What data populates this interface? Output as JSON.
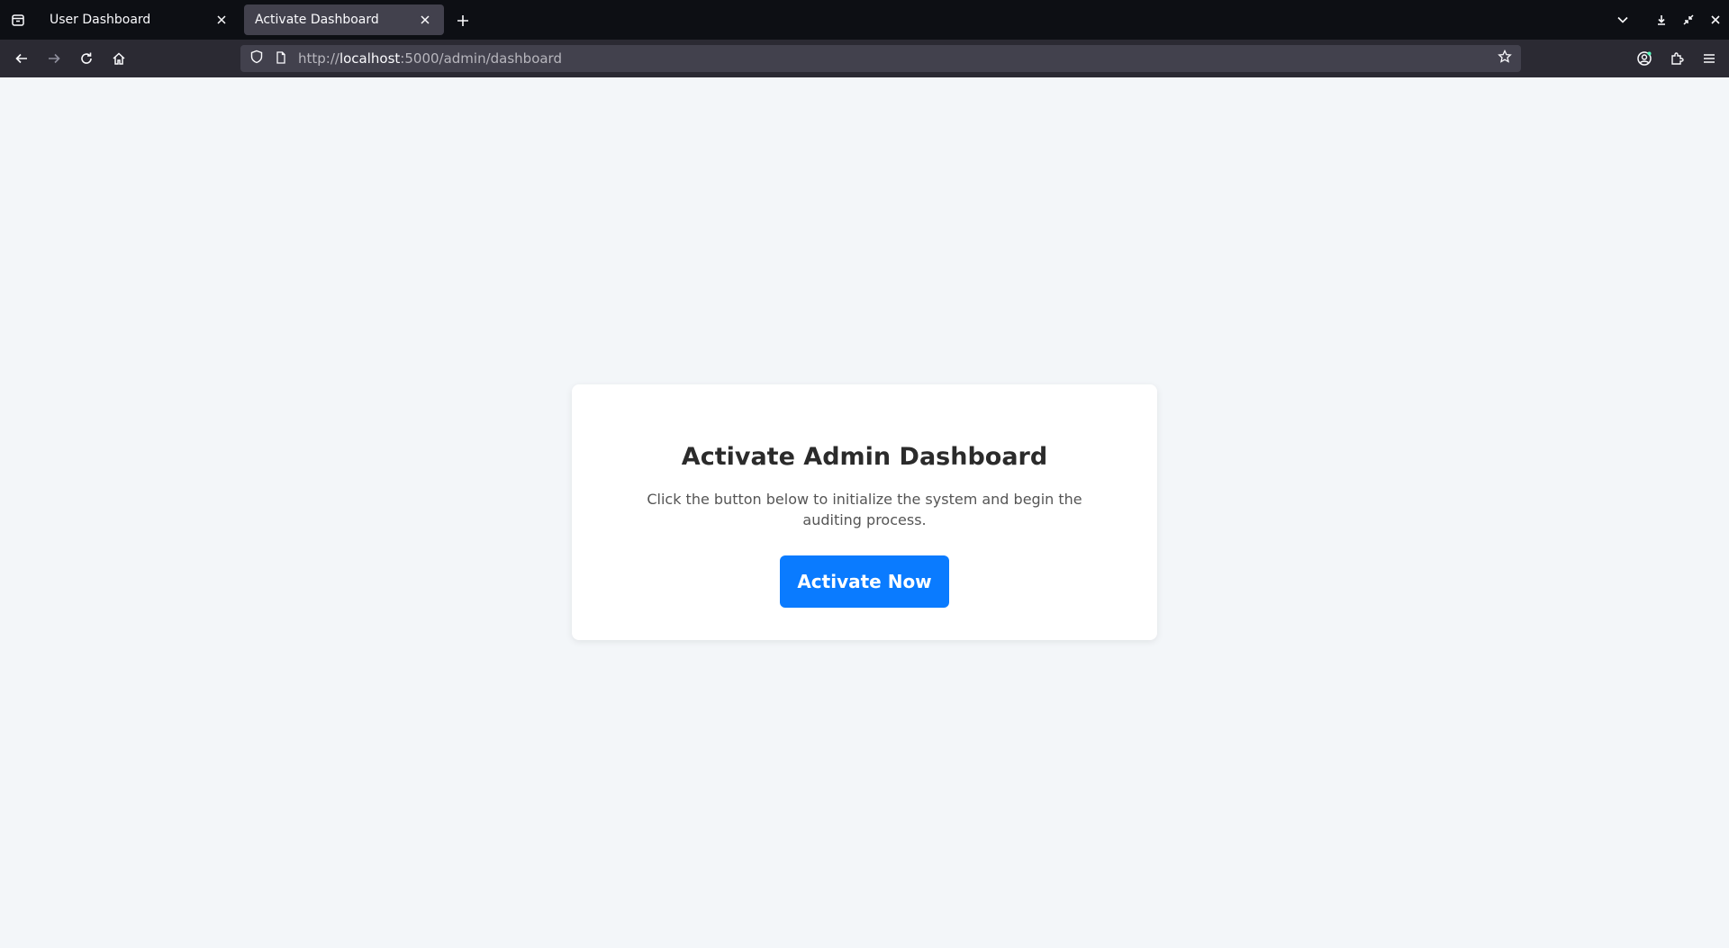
{
  "browser": {
    "tabs": [
      {
        "label": "User Dashboard",
        "active": false
      },
      {
        "label": "Activate Dashboard",
        "active": true
      }
    ],
    "url": {
      "scheme": "http://",
      "host": "localhost",
      "rest": ":5000/admin/dashboard"
    },
    "icons": {
      "tab_list": "tab-list-icon",
      "new_tab": "plus-icon",
      "list_all_tabs": "chevron-down-icon",
      "downloads": "download-icon",
      "restore": "restore-icon",
      "close_window": "close-icon",
      "back": "back-arrow-icon",
      "forward": "forward-arrow-icon",
      "reload": "reload-icon",
      "home": "home-icon",
      "shield": "shield-icon",
      "page": "page-icon",
      "bookmark": "star-icon",
      "account": "account-icon",
      "extensions": "puzzle-icon",
      "menu": "hamburger-menu-icon"
    }
  },
  "card": {
    "title": "Activate Admin Dashboard",
    "description": "Click the button below to initialize the system and begin the auditing process.",
    "button_label": "Activate Now"
  },
  "colors": {
    "accent": "#0a7bff",
    "page_background": "#f3f6f9",
    "card_background": "#ffffff"
  }
}
